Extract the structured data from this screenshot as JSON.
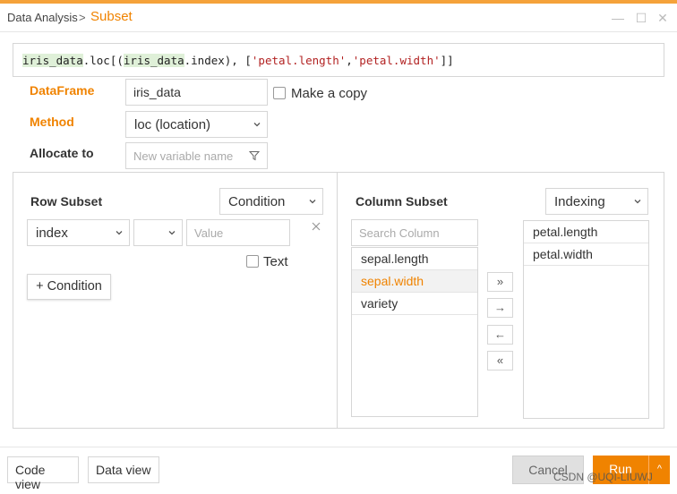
{
  "title": {
    "main": "Data Analysis",
    "separator": ">",
    "sub": "Subset"
  },
  "window_controls": {
    "minimize": "—",
    "maximize": "☐",
    "close": "✕"
  },
  "code": {
    "var1": "iris_data",
    "part1": ".loc[(",
    "var2": "iris_data",
    "part2": ".index), [",
    "str1": "'petal.length'",
    "comma": ",",
    "str2": "'petal.width'",
    "part3": "]]"
  },
  "form": {
    "dataframe_label": "DataFrame",
    "dataframe_value": "iris_data",
    "make_copy_label": "Make a copy",
    "method_label": "Method",
    "method_value": "loc (location)",
    "allocate_label": "Allocate to",
    "allocate_placeholder": "New variable name"
  },
  "row_subset": {
    "title": "Row Subset",
    "mode": "Condition",
    "column_select": "index",
    "operator_select": "",
    "value_placeholder": "Value",
    "text_label": "Text",
    "add_condition": "+ Condition"
  },
  "column_subset": {
    "title": "Column Subset",
    "mode": "Indexing",
    "search_placeholder": "Search Column",
    "available": [
      "sepal.length",
      "sepal.width",
      "variety"
    ],
    "selected_available": "sepal.width",
    "chosen": [
      "petal.length",
      "petal.width"
    ],
    "move_buttons": [
      "»",
      "→",
      "←",
      "«"
    ]
  },
  "footer": {
    "code_view": "Code view",
    "data_view": "Data view",
    "cancel": "Cancel",
    "run": "Run",
    "run_menu": "^"
  },
  "watermark": "CSDN @UQI-LIUWJ",
  "colors": {
    "accent": "#f08300",
    "topbar": "#f5a23a",
    "border": "#d6d6d6"
  }
}
